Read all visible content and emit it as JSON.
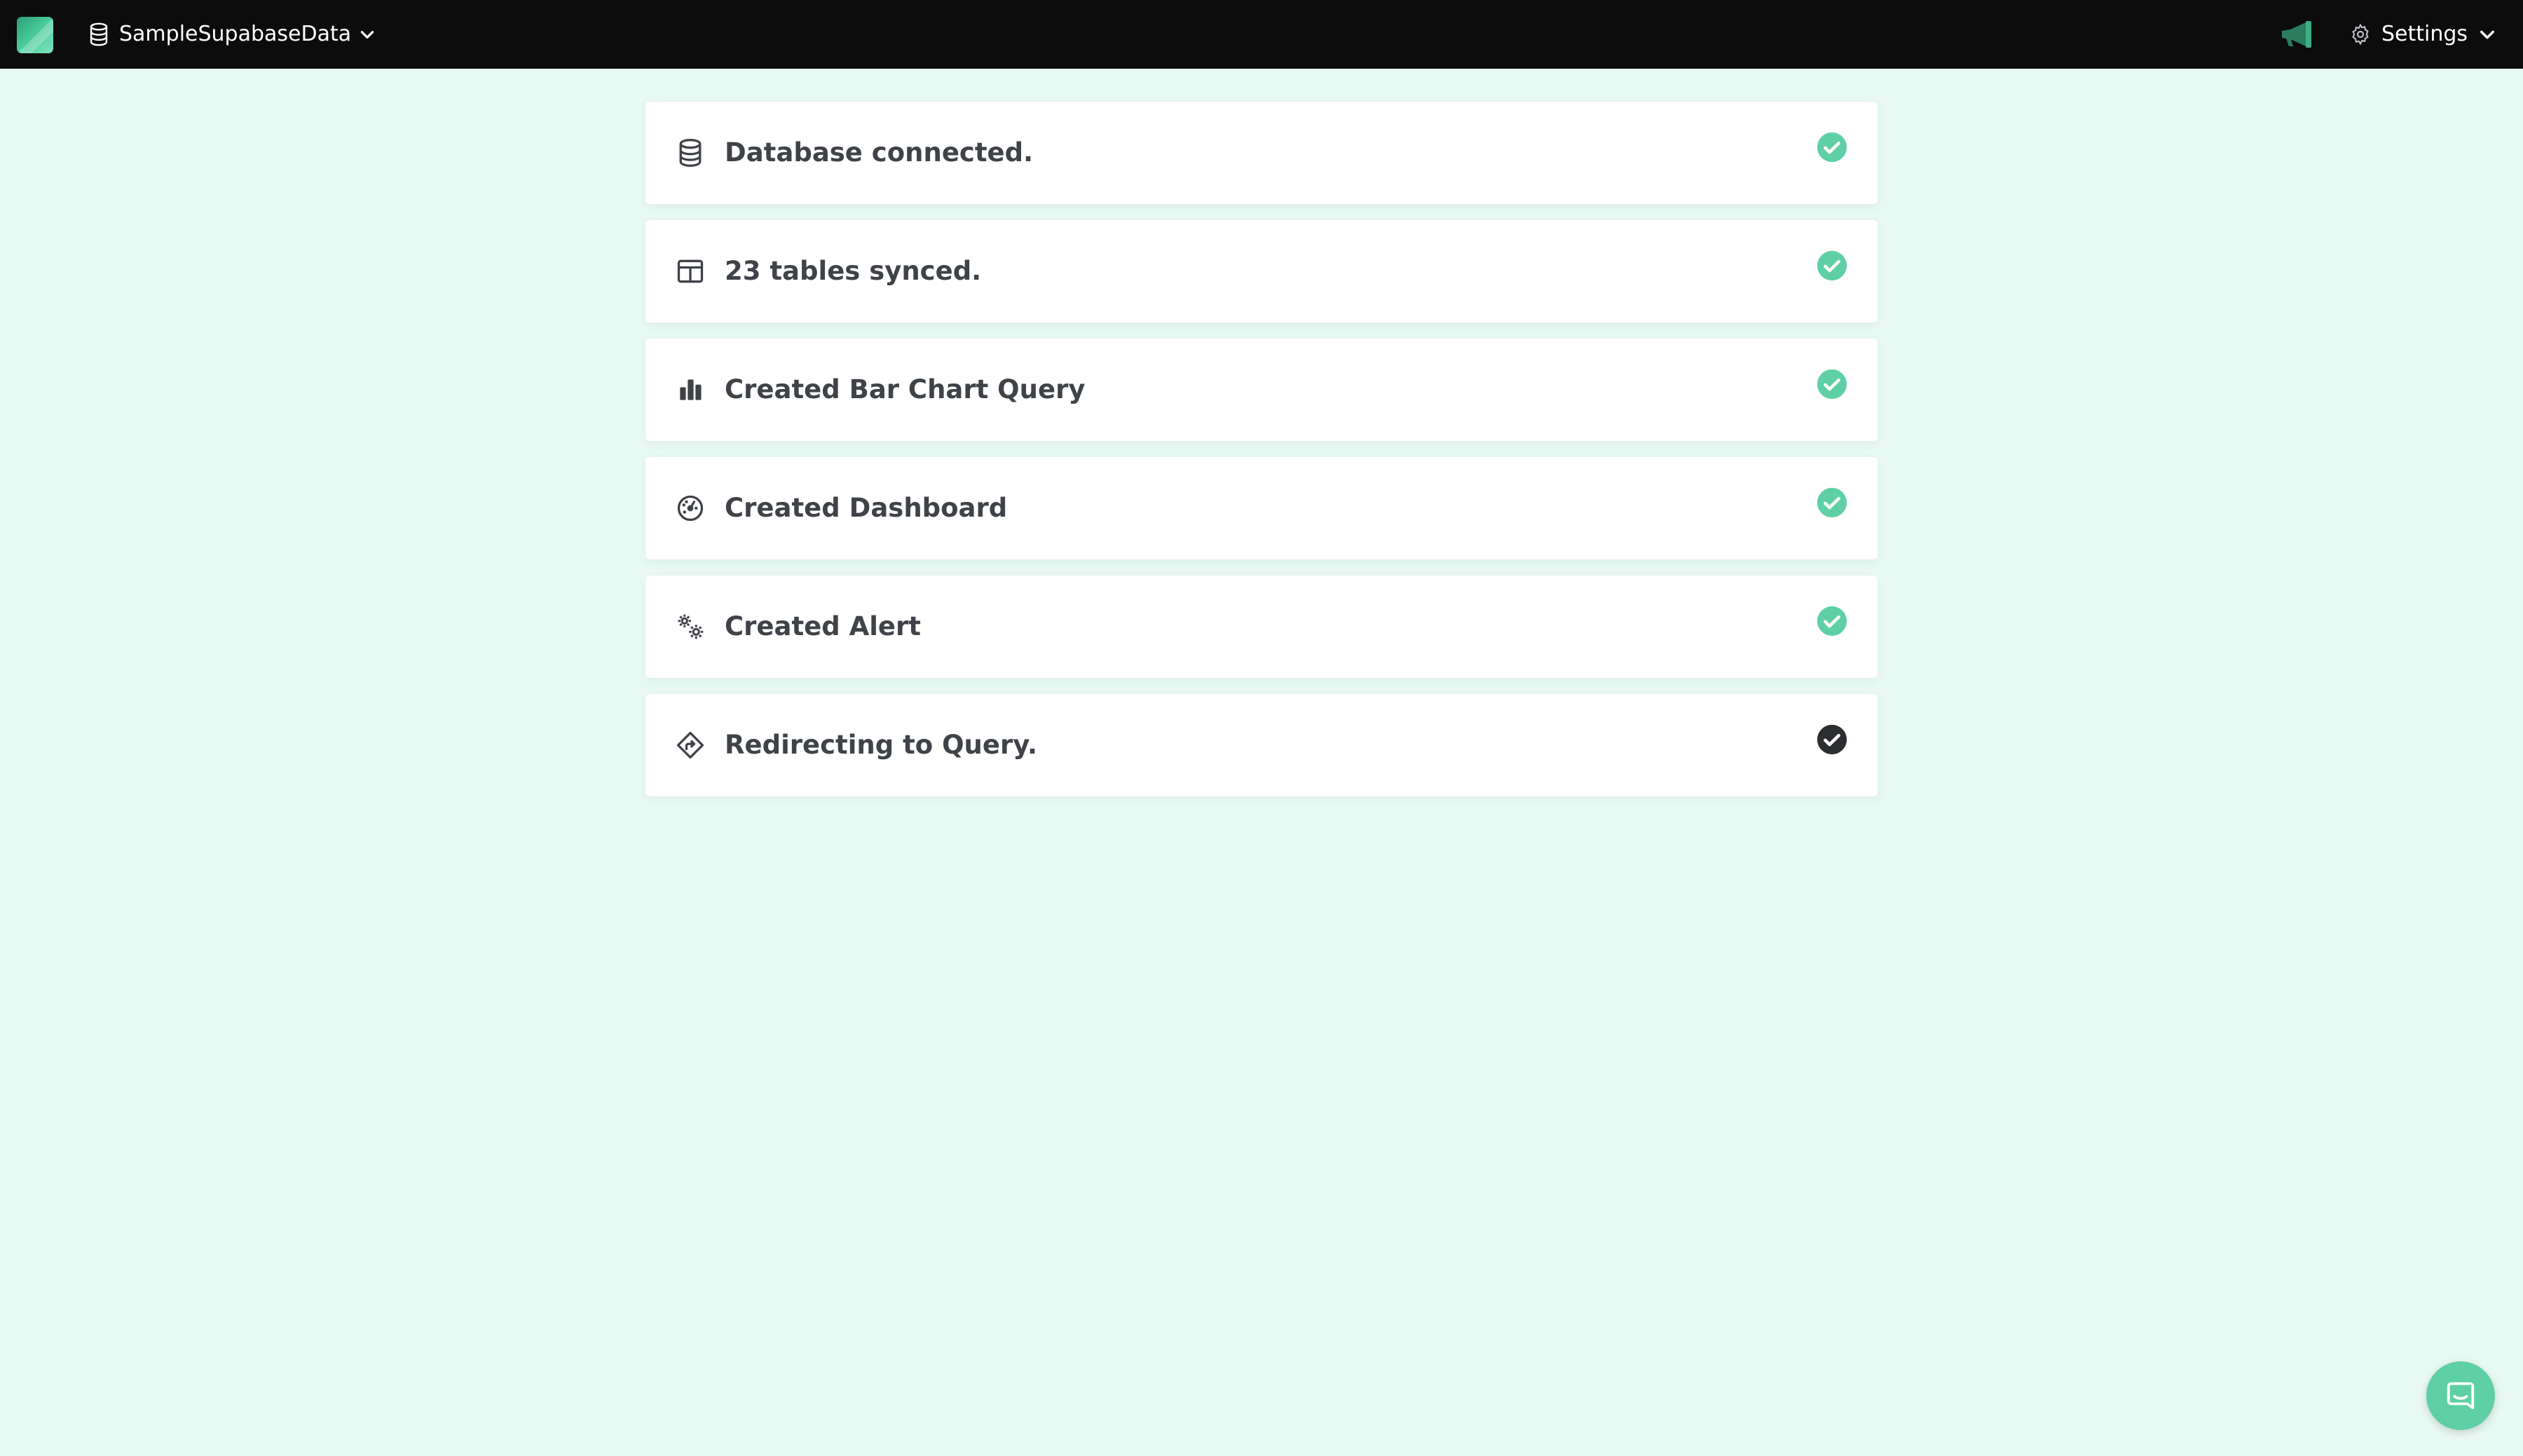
{
  "header": {
    "database_name": "SampleSupabaseData",
    "settings_label": "Settings",
    "icons": {
      "logo": "app-logo",
      "database": "database-icon",
      "announcement": "megaphone-icon",
      "settings": "gear-icon",
      "dropdown": "chevron-down-icon"
    }
  },
  "steps": [
    {
      "label": "Database connected.",
      "icon": "database-icon",
      "status": "complete"
    },
    {
      "label": "23 tables synced.",
      "icon": "table-icon",
      "status": "complete"
    },
    {
      "label": "Created Bar Chart Query",
      "icon": "bar-chart-icon",
      "status": "complete"
    },
    {
      "label": "Created Dashboard",
      "icon": "dashboard-gauge-icon",
      "status": "complete"
    },
    {
      "label": "Created Alert",
      "icon": "gears-icon",
      "status": "complete"
    },
    {
      "label": "Redirecting to Query.",
      "icon": "redirect-diamond-icon",
      "status": "in-progress"
    }
  ],
  "colors": {
    "background": "#e8f8f3",
    "topbar": "#0c0c0c",
    "accent": "#5fcfa6",
    "check_complete": "#5fcfa6",
    "check_current": "#2b2d31",
    "step_text": "#3f4348"
  },
  "chat": {
    "icon": "chat-icon"
  }
}
